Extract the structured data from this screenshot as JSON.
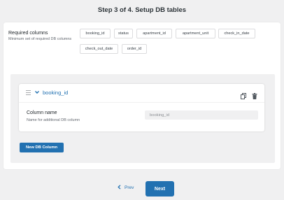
{
  "step_title": "Step 3 of 4. Setup DB tables",
  "required": {
    "label": "Required columns",
    "description": "Minimum set of required DB columns",
    "chips": [
      "booking_id",
      "status",
      "apartment_id",
      "apartment_unit",
      "check_in_date",
      "check_out_date",
      "order_id"
    ]
  },
  "column_item": {
    "title": "booking_id",
    "field_label": "Column name",
    "field_description": "Name for additional DB column",
    "field_value": "booking_id"
  },
  "buttons": {
    "new_column": "New DB Column",
    "prev": "Prev",
    "next": "Next"
  },
  "colors": {
    "accent": "#2271b1",
    "background": "#f0f0f1"
  },
  "icons": {
    "drag": "drag-handle-icon",
    "expand": "chevron-down-icon",
    "copy": "copy-icon",
    "delete": "trash-icon",
    "prev": "chevron-left-icon"
  }
}
